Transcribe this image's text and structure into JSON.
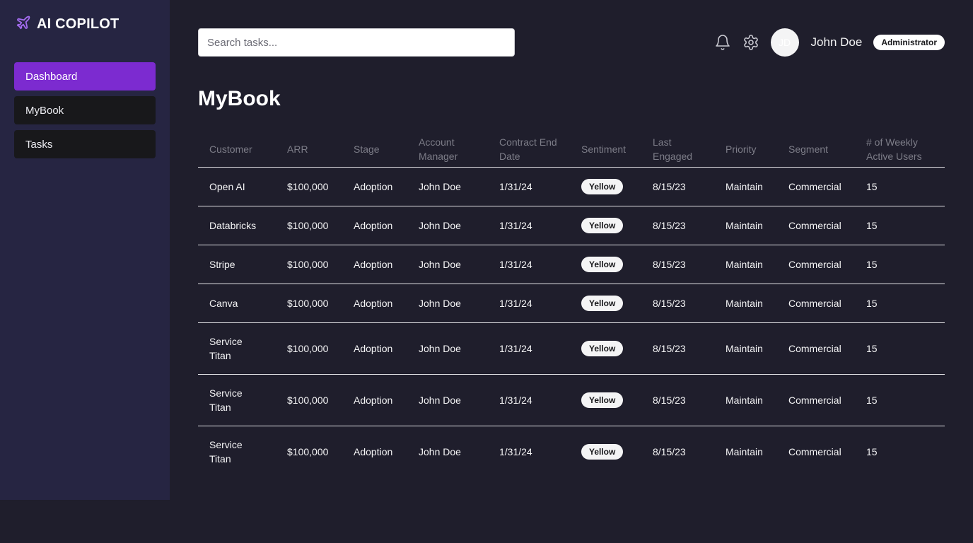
{
  "app": {
    "title": "AI COPILOT",
    "logo_icon": "plane-icon"
  },
  "sidebar": {
    "items": [
      {
        "label": "Dashboard",
        "active": true
      },
      {
        "label": "MyBook",
        "active": false
      },
      {
        "label": "Tasks",
        "active": false
      }
    ]
  },
  "search": {
    "placeholder": "Search tasks...",
    "value": ""
  },
  "header": {
    "user_initials": "JD",
    "user_name": "John Doe",
    "role": "Administrator",
    "icons": [
      "bell-icon",
      "gear-icon"
    ]
  },
  "page": {
    "title": "MyBook"
  },
  "table": {
    "columns": [
      "Customer",
      "ARR",
      "Stage",
      "Account Manager",
      "Contract End Date",
      "Sentiment",
      "Last Engaged",
      "Priority",
      "Segment",
      "# of Weekly Active Users"
    ],
    "rows": [
      [
        "Open AI",
        "$100,000",
        "Adoption",
        "John Doe",
        "1/31/24",
        "Yellow",
        "8/15/23",
        "Maintain",
        "Commercial",
        "15"
      ],
      [
        "Databricks",
        "$100,000",
        "Adoption",
        "John Doe",
        "1/31/24",
        "Yellow",
        "8/15/23",
        "Maintain",
        "Commercial",
        "15"
      ],
      [
        "Stripe",
        "$100,000",
        "Adoption",
        "John Doe",
        "1/31/24",
        "Yellow",
        "8/15/23",
        "Maintain",
        "Commercial",
        "15"
      ],
      [
        "Canva",
        "$100,000",
        "Adoption",
        "John Doe",
        "1/31/24",
        "Yellow",
        "8/15/23",
        "Maintain",
        "Commercial",
        "15"
      ],
      [
        "Service Titan",
        "$100,000",
        "Adoption",
        "John Doe",
        "1/31/24",
        "Yellow",
        "8/15/23",
        "Maintain",
        "Commercial",
        "15"
      ],
      [
        "Service Titan",
        "$100,000",
        "Adoption",
        "John Doe",
        "1/31/24",
        "Yellow",
        "8/15/23",
        "Maintain",
        "Commercial",
        "15"
      ],
      [
        "Service Titan",
        "$100,000",
        "Adoption",
        "John Doe",
        "1/31/24",
        "Yellow",
        "8/15/23",
        "Maintain",
        "Commercial",
        "15"
      ]
    ]
  },
  "colors": {
    "background": "#1f1e2c",
    "sidebar": "#262542",
    "accent": "#7c2bd0",
    "nav_item": "#18181b"
  }
}
